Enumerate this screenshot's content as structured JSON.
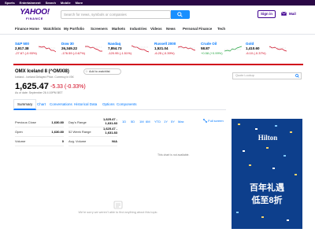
{
  "topbar": {
    "items": [
      "Sports",
      "Entertainment",
      "Search",
      "Mobile",
      "More"
    ]
  },
  "header": {
    "logo_line1": "YAHOO!",
    "logo_line2": "FINANCE",
    "search_placeholder": "Search for news, symbols or companies",
    "signin_label": "Sign in",
    "mail_label": "Mail"
  },
  "nav": {
    "items": [
      "Finance Home",
      "Watchlists",
      "My Portfolio",
      "Screeners",
      "Markets",
      "Industries",
      "Videos",
      "News",
      "Personal Finance",
      "Tech"
    ]
  },
  "tickers": [
    {
      "name": "S&P 500",
      "price": "2,917.38",
      "change": "-27.67 (-0.93%)",
      "dir": "neg"
    },
    {
      "name": "Dow 30",
      "price": "26,349.22",
      "change": "-176.59 (-0.67%)",
      "dir": "neg"
    },
    {
      "name": "Nasdaq",
      "price": "7,854.73",
      "change": "-120.95 (-1.51%)",
      "dir": "neg"
    },
    {
      "name": "Russell 2000",
      "price": "1,521.04",
      "change": "-6.25 (-0.39%)",
      "dir": "neg"
    },
    {
      "name": "Crude Oil",
      "price": "58.87",
      "change": "+0.58 (+0.99%)",
      "dir": "pos"
    },
    {
      "name": "Gold",
      "price": "1,410.60",
      "change": "-6.10 (-0.37%)",
      "dir": "neg"
    }
  ],
  "quote": {
    "title": "OMX Iceland 8 (^OMXI8)",
    "watchlist_label": "Add to watchlist",
    "subtitle": "Iceland - Iceland Delayed Price. Currency in ISK",
    "price": "1,625.47",
    "change": "-5.33 (-0.33%)",
    "time": "As of date: September 26 4:19PM BST",
    "quote_lookup_placeholder": "Quote Lookup"
  },
  "tabs": [
    "Summary",
    "Chart",
    "Conversations",
    "Historical Data",
    "Options",
    "Components"
  ],
  "summary": [
    {
      "label": "Previous Close",
      "value": "1,630.80"
    },
    {
      "label": "Open",
      "value": "1,630.80"
    },
    {
      "label": "Volume",
      "value": "0"
    },
    {
      "label": "Day's Range",
      "value": "1,625.47 - 1,631.83"
    },
    {
      "label": "52 Week Range",
      "value": "1,625.47 - 1,631.83"
    },
    {
      "label": "Avg. Volume",
      "value": "N/A"
    }
  ],
  "chart": {
    "ranges": [
      "1D",
      "5D",
      "1M",
      "6M",
      "YTD",
      "1Y",
      "5Y",
      "Max"
    ],
    "fullscreen_label": "Full screen",
    "unavailable": "This chart is not available."
  },
  "empty_state": "We're sorry we weren't able to find anything about this topic.",
  "ad": {
    "brand": "Hilton",
    "line1": "百年礼遇",
    "line2": "低至8折"
  },
  "colors": {
    "brand": "#400090",
    "accent": "#0078ff",
    "negative": "#d0021b",
    "positive": "#21a33d"
  }
}
